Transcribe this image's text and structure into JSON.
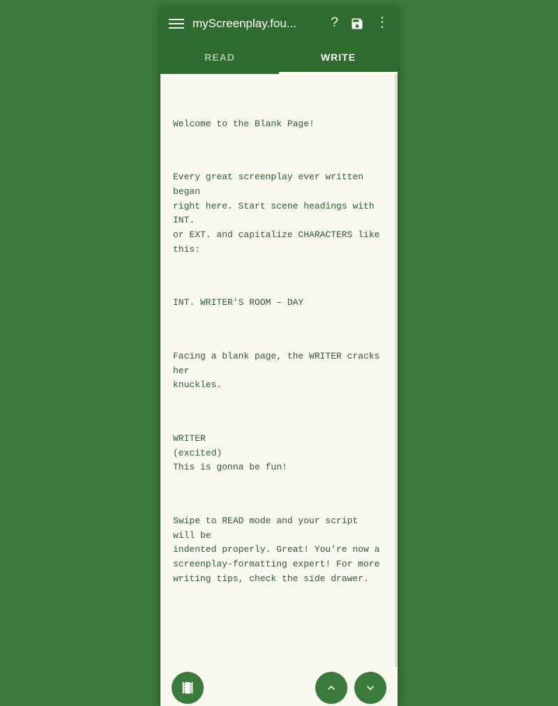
{
  "app": {
    "title": "myScreenplay.fou...",
    "hamburger_label": "Menu"
  },
  "tabs": [
    {
      "id": "read",
      "label": "READ",
      "active": false
    },
    {
      "id": "write",
      "label": "WRITE",
      "active": true
    }
  ],
  "icons": {
    "help": "?",
    "save": "💾",
    "more": "⋮",
    "film": "🎬",
    "up_arrow": "∧",
    "down_arrow": "∨"
  },
  "content": {
    "paragraphs": [
      "Welcome to the Blank Page!",
      "Every great screenplay ever written began\nright here. Start scene headings with INT.\nor EXT. and capitalize CHARACTERS like this:",
      "INT. WRITER'S ROOM – DAY",
      "Facing a blank page, the WRITER cracks her\nknuckles.",
      "WRITER\n(excited)\nThis is gonna be fun!",
      "Swipe to READ mode and your script will be\nindented properly. Great! You're now a\nscreenplay-formatting expert! For more\nwriting tips, check the side drawer."
    ]
  },
  "colors": {
    "dark_green": "#2e6b2e",
    "medium_green": "#3a7a3a",
    "text_green": "#2d5a2d",
    "white": "#ffffff",
    "paper": "#f8f8f0"
  }
}
